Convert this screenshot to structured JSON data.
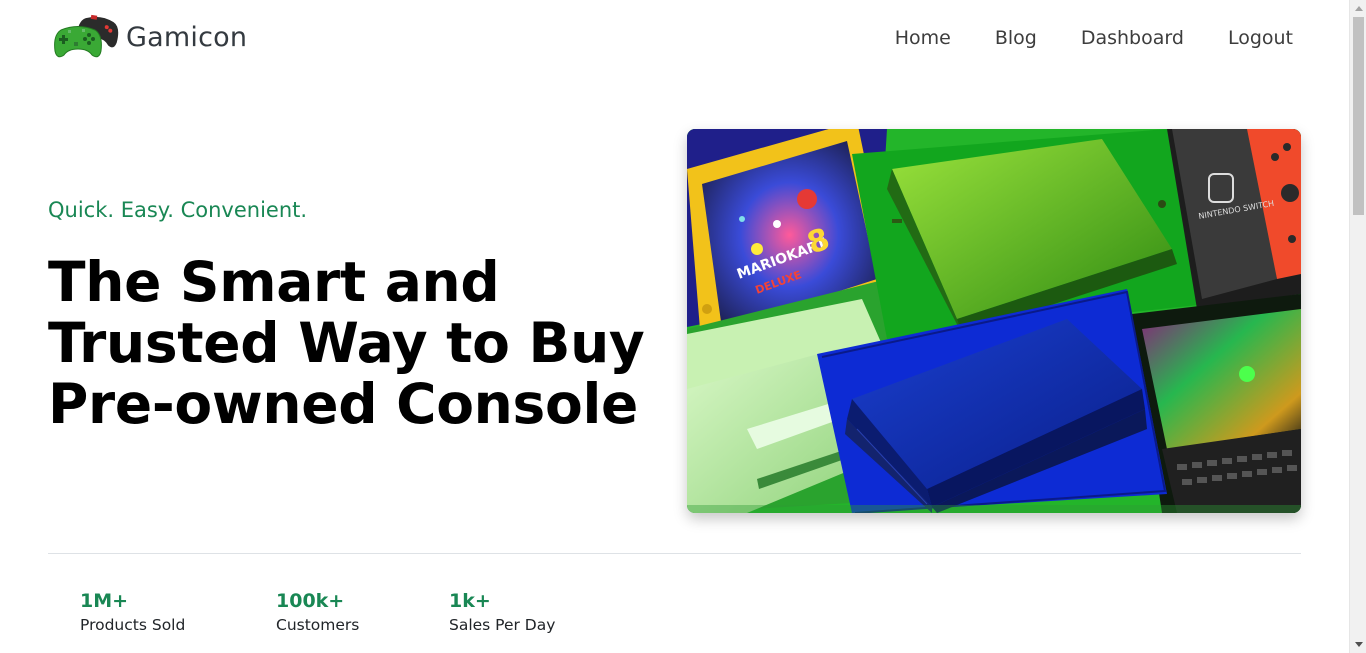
{
  "brand": {
    "name": "Gamicon",
    "logo_icon": "game-controller-icon"
  },
  "nav": {
    "links": [
      {
        "label": "Home"
      },
      {
        "label": "Blog"
      },
      {
        "label": "Dashboard"
      },
      {
        "label": "Logout"
      }
    ]
  },
  "hero": {
    "tagline": "Quick. Easy. Convenient.",
    "headline_line1": "The Smart and",
    "headline_line2": "Trusted Way to Buy",
    "headline_line3": "Pre-owned Console",
    "image_text": {
      "switch_logo": "NINTENDO SWITCH",
      "game_title_1": "MARIOKART",
      "game_title_2": "DELUXE",
      "game_number": "8"
    }
  },
  "stats": [
    {
      "value": "1M+",
      "label": "Products Sold"
    },
    {
      "value": "100k+",
      "label": "Customers"
    },
    {
      "value": "1k+",
      "label": "Sales Per Day"
    }
  ],
  "colors": {
    "accent": "#198754",
    "heading": "#000000",
    "nav_text": "#3d3d3d",
    "divider": "#dee2e6"
  }
}
